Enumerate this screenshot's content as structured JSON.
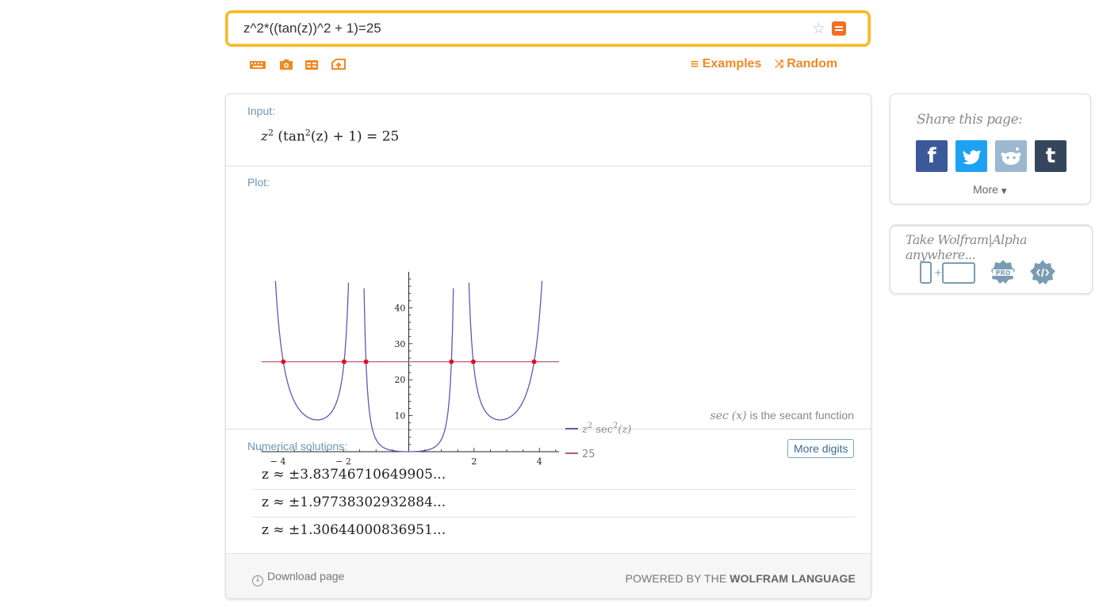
{
  "search": {
    "query": "z^2*((tan(z))^2 + 1)=25"
  },
  "toolbar": {
    "icons": [
      "keyboard-icon",
      "camera-icon",
      "table-icon",
      "upload-icon"
    ],
    "examples_label": "Examples",
    "random_label": "Random"
  },
  "pods": {
    "input": {
      "title": "Input:",
      "expr": {
        "a": "z",
        "a_sup": "2",
        "b": " (tan",
        "b_sup": "2",
        "c": "(z) + 1) = 25"
      }
    },
    "plot": {
      "title": "Plot:",
      "note_prefix": "sec",
      "note_arg": "(x)",
      "note_suffix": "is the secant function"
    },
    "numerical": {
      "title": "Numerical solutions:",
      "more_digits_label": "More digits",
      "solutions": [
        "z ≈ ±3.83746710649905...",
        "z ≈ ±1.97738302932884...",
        "z ≈ ±1.30644000836951..."
      ]
    }
  },
  "footer": {
    "download_label": "Download page",
    "powered_prefix": "POWERED BY THE",
    "powered_brand": "WOLFRAM LANGUAGE"
  },
  "share": {
    "title": "Share this page:",
    "buttons": [
      {
        "glyph": "f",
        "color": "#3b5998"
      },
      {
        "glyph": "t",
        "color": "#1da1f2"
      },
      {
        "glyph": "r",
        "color": "#9bb8d0"
      },
      {
        "glyph": "t",
        "color": "#35465c"
      }
    ],
    "more_label": "More"
  },
  "anywhere": {
    "title": "Take Wolfram|Alpha anywhere...",
    "icons": [
      "devices-icon",
      "pro-badge-icon",
      "widget-icon"
    ]
  },
  "chart_data": {
    "type": "line",
    "x_range": [
      -4.5,
      4.6
    ],
    "y_range": [
      0,
      50
    ],
    "x_ticks": [
      -4,
      -2,
      2,
      4
    ],
    "y_ticks": [
      10,
      20,
      30,
      40
    ],
    "series": [
      {
        "name": "z^2 sec^2(z)",
        "color": "#5a5ab5",
        "function": "z^2*sec(z)^2"
      },
      {
        "name": "25",
        "color": "#b5577e",
        "constant": 25
      }
    ],
    "intersections_x": [
      -3.83746710649905,
      -1.97738302932884,
      -1.30644000836951,
      1.30644000836951,
      1.97738302932884,
      3.83746710649905
    ],
    "legend": {
      "series0": {
        "base": "z",
        "sup1": "2",
        "mid": " sec",
        "sup2": "2",
        "arg": "(z)"
      },
      "series1": "25"
    }
  }
}
